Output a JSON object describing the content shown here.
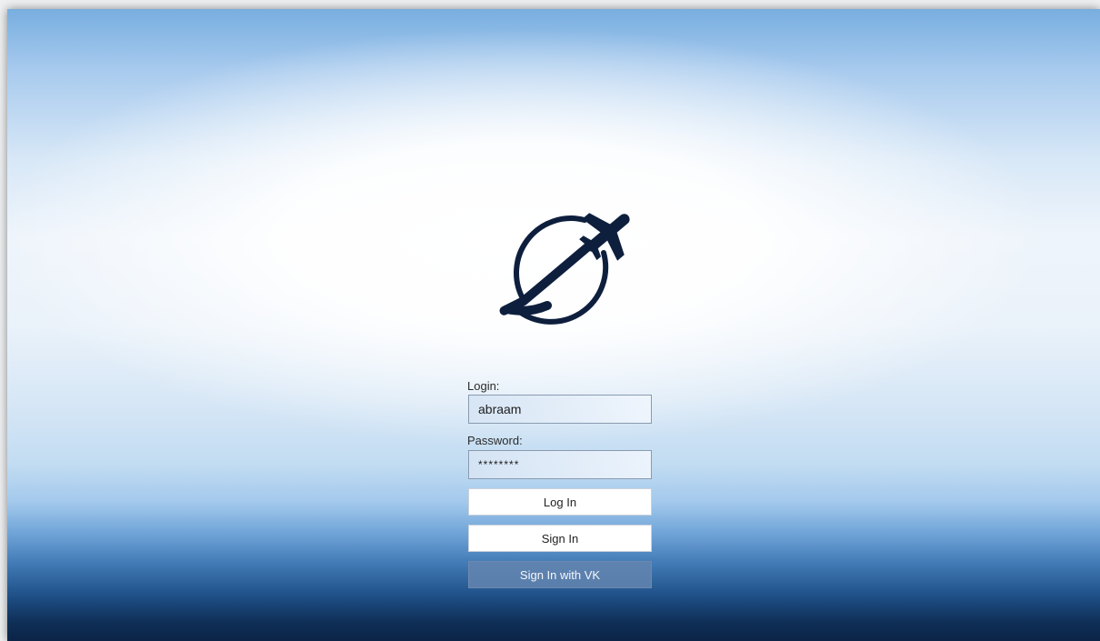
{
  "login_form": {
    "login_label": "Login:",
    "login_value": "abraam",
    "password_label": "Password:",
    "password_value": "********",
    "log_in_button": "Log In",
    "sign_in_button": "Sign In",
    "sign_in_vk_button": "Sign In with VK"
  },
  "logo": {
    "icon": "globe-airplane-icon",
    "color": "#0e1f3d"
  }
}
